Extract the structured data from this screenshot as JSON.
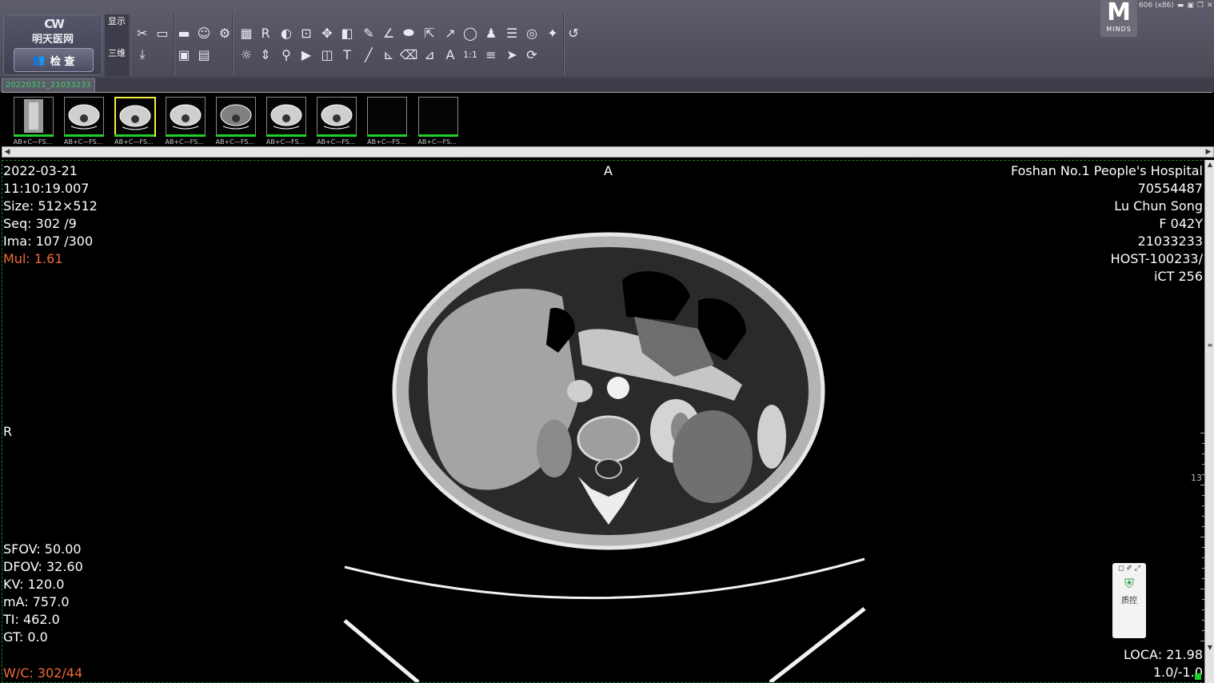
{
  "app": {
    "logo_mark": "CW",
    "logo_text": "明天医网",
    "exam_button": "检 查",
    "mode_display": "显示",
    "mode_3d": "三维",
    "minds_mark": "M",
    "minds_text": "MINDS",
    "window_title_fragment": "606 (x86)"
  },
  "toolbar_icons": [
    "scissors-icon",
    "monitor-icon",
    "folder-open-icon",
    "patient-info-icon",
    "settings-icon",
    "grid-layout-icon",
    "rr-icon",
    "window-level-icon",
    "zoom-box-icon",
    "pan-icon",
    "invert-icon",
    "pencil-icon",
    "angle-icon",
    "ellipse-icon",
    "export-icon",
    "arrow-icon",
    "circle-icon",
    "person-icon",
    "report-icon",
    "stack-icon",
    "magic-wand-icon",
    "rotate-icon",
    "download-icon",
    "film-icon",
    "save-icon",
    "brightness-icon",
    "flip-icon",
    "magnify-icon",
    "play-icon",
    "split-icon",
    "text-icon",
    "line-icon",
    "right-angle-icon",
    "eraser-icon",
    "ruler-icon",
    "annotation-a-icon",
    "one-to-one-icon",
    "align-icon",
    "cursor-icon",
    "refresh-icon"
  ],
  "study_tab": "20220321_21033233",
  "thumbnails": [
    {
      "label": "AB+C—FS...",
      "kind": "scout",
      "selected": false
    },
    {
      "label": "AB+C—FS...",
      "kind": "axial",
      "selected": false
    },
    {
      "label": "AB+C—FS...",
      "kind": "axial",
      "selected": true
    },
    {
      "label": "AB+C—FS...",
      "kind": "axial",
      "selected": false
    },
    {
      "label": "AB+C—FS...",
      "kind": "axial-gray",
      "selected": false
    },
    {
      "label": "AB+C—FS...",
      "kind": "axial",
      "selected": false
    },
    {
      "label": "AB+C—FS...",
      "kind": "axial",
      "selected": false
    },
    {
      "label": "AB+C—FS...",
      "kind": "empty",
      "selected": false
    },
    {
      "label": "AB+C—FS...",
      "kind": "empty",
      "selected": false
    }
  ],
  "overlay": {
    "top_left": [
      "2022-03-21",
      "11:10:19.007",
      "Size: 512×512",
      "Seq: 302 /9",
      "Ima: 107 /300"
    ],
    "mul": "Mul: 1.61",
    "top_center": "A",
    "left_center": "R",
    "top_right": [
      "Foshan No.1 People's Hospital",
      "70554487",
      "Lu Chun Song",
      "F 042Y",
      "21033233",
      "HOST-100233/",
      "iCT 256"
    ],
    "bottom_left": [
      "SFOV: 50.00",
      "DFOV: 32.60",
      "KV: 120.0",
      "mA: 757.0",
      "TI: 462.0",
      "GT: 0.0"
    ],
    "wc": "W/C: 302/44",
    "bottom_right": [
      "LOCA: 21.98",
      "1.0/-1.0"
    ],
    "ruler_label": "13"
  },
  "qc_widget": {
    "label": "质控"
  },
  "colors": {
    "accent_green": "#1fcf2a",
    "overlay_orange": "#f06a3a",
    "selected_yellow": "#f1ec4a"
  }
}
